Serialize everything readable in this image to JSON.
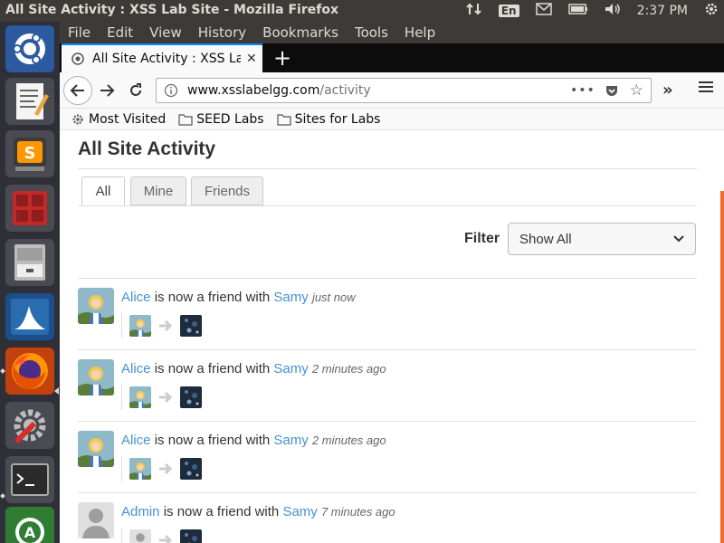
{
  "system": {
    "window_title": "All Site Activity : XSS Lab Site - Mozilla Firefox",
    "keyboard_layout": "En",
    "clock": "2:37 PM"
  },
  "launcher": {
    "items": [
      "ubuntu-icon",
      "text-editor-icon",
      "sublime-text-icon",
      "terminal-red-icon",
      "file-cabinet-icon",
      "wireshark-icon",
      "firefox-icon",
      "settings-icon",
      "terminal-icon",
      "update-icon"
    ]
  },
  "menubar": {
    "items": [
      "File",
      "Edit",
      "View",
      "History",
      "Bookmarks",
      "Tools",
      "Help"
    ]
  },
  "browser": {
    "tab_title": "All Site Activity : XSS Lab Site",
    "url_host": "www.xsslabelgg.com",
    "url_path": "/activity",
    "url_actions": "•••",
    "bookmarks": [
      "Most Visited",
      "SEED Labs",
      "Sites for Labs"
    ]
  },
  "page": {
    "title": "All Site Activity",
    "tabs": [
      {
        "label": "All",
        "active": true
      },
      {
        "label": "Mine",
        "active": false
      },
      {
        "label": "Friends",
        "active": false
      }
    ],
    "filter_label": "Filter",
    "filter_value": "Show All",
    "activities": [
      {
        "actor": "Alice",
        "verb": "is now a friend with",
        "target": "Samy",
        "time": "just now",
        "actor_avatar": "alice"
      },
      {
        "actor": "Alice",
        "verb": "is now a friend with",
        "target": "Samy",
        "time": "2 minutes ago",
        "actor_avatar": "alice"
      },
      {
        "actor": "Alice",
        "verb": "is now a friend with",
        "target": "Samy",
        "time": "2 minutes ago",
        "actor_avatar": "alice"
      },
      {
        "actor": "Admin",
        "verb": "is now a friend with",
        "target": "Samy",
        "time": "7 minutes ago",
        "actor_avatar": "default"
      }
    ]
  },
  "colors": {
    "link": "#4690d6",
    "tab_accent": "#0a84ff",
    "panel": "#3c3b37",
    "launcher": "#2f2f38"
  }
}
